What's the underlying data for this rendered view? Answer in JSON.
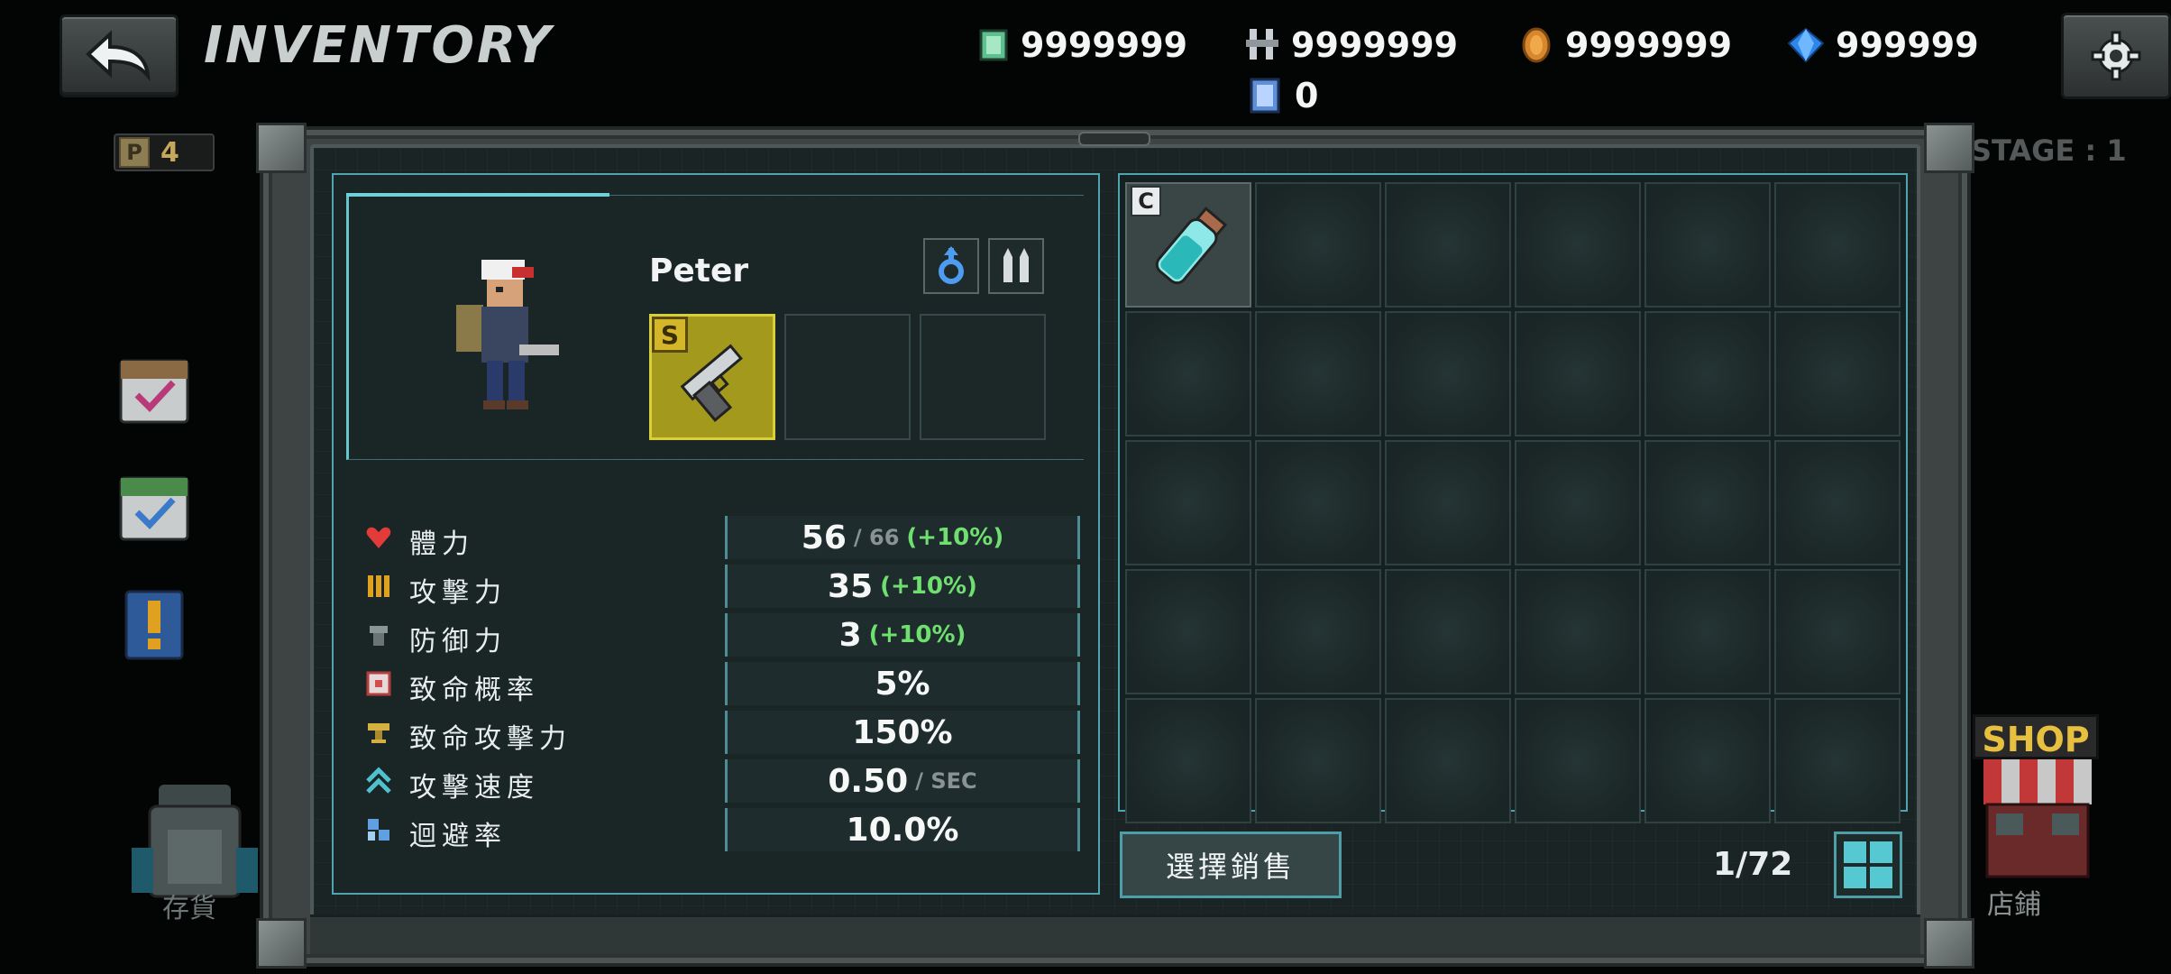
{
  "header": {
    "title": "INVENTORY"
  },
  "currencies": [
    {
      "icon": "cash-icon",
      "value": "9999999"
    },
    {
      "icon": "bolts-icon",
      "value": "9999999"
    },
    {
      "icon": "coin-icon",
      "value": "9999999"
    },
    {
      "icon": "gem-icon",
      "value": "999999"
    },
    {
      "icon": "ticket-icon",
      "value": "0"
    }
  ],
  "points_badge": {
    "label": "P",
    "value": "4"
  },
  "stage": {
    "text": "STAGE : 1"
  },
  "side_menu": {
    "storage_label": "存貨",
    "shop_sign": "SHOP",
    "shop_label": "店鋪"
  },
  "character": {
    "name": "Peter",
    "weapon_grade": "S"
  },
  "stats": [
    {
      "icon": "heart-icon",
      "label": "體力",
      "main": "56",
      "sub": "/ 66",
      "bonus": "(+10%)",
      "color": "#e33a3a"
    },
    {
      "icon": "attack-icon",
      "label": "攻擊力",
      "main": "35",
      "sub": "",
      "bonus": "(+10%)",
      "color": "#e0a020"
    },
    {
      "icon": "defense-icon",
      "label": "防御力",
      "main": "3",
      "sub": "",
      "bonus": "(+10%)",
      "color": "#8a9696"
    },
    {
      "icon": "crit-rate-icon",
      "label": "致命概率",
      "main": "5%",
      "sub": "",
      "bonus": "",
      "color": "#d05050"
    },
    {
      "icon": "crit-damage-icon",
      "label": "致命攻擊力",
      "main": "150%",
      "sub": "",
      "bonus": "",
      "color": "#d4b040"
    },
    {
      "icon": "attack-speed-icon",
      "label": "攻擊速度",
      "main": "0.50",
      "sub": "/ SEC",
      "bonus": "",
      "color": "#4fc0d0"
    },
    {
      "icon": "evasion-icon",
      "label": "迴避率",
      "main": "10.0%",
      "sub": "",
      "bonus": "",
      "color": "#60a0e0"
    }
  ],
  "inventory": {
    "items": [
      {
        "slot": 0,
        "grade": "C",
        "icon": "potion-vial-icon"
      }
    ],
    "capacity": "1/72",
    "sell_button": "選擇銷售"
  },
  "colors": {
    "accent": "#4fa4ad",
    "bonus": "#6fe06f",
    "weapon_slot": "#a39a1d"
  }
}
